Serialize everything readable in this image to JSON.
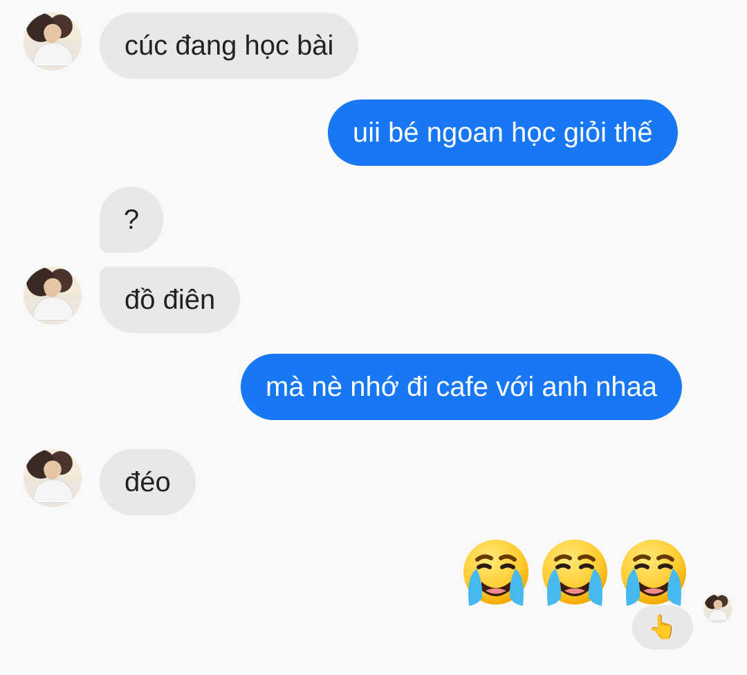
{
  "messages": [
    {
      "side": "incoming",
      "text": "cúc đang học bài"
    },
    {
      "side": "outgoing",
      "text": "uii bé ngoan học giỏi thế"
    },
    {
      "side": "incoming",
      "text": "?"
    },
    {
      "side": "incoming",
      "text": "đồ điên"
    },
    {
      "side": "outgoing",
      "text": "mà nè nhớ đi cafe với anh nhaa"
    },
    {
      "side": "incoming",
      "text": "đéo"
    }
  ],
  "emoji_message": {
    "items": [
      "😭",
      "😭",
      "😭"
    ],
    "reaction": "👆"
  },
  "icons": {
    "avatar": "user-avatar",
    "emoji": "loudly-crying-face-icon",
    "reaction": "pointing-up-reaction"
  },
  "colors": {
    "background": "#f9f9f9",
    "incoming_bubble": "#e8e8e8",
    "outgoing_bubble": "#1877f2",
    "incoming_text": "#222222",
    "outgoing_text": "#ffffff"
  }
}
